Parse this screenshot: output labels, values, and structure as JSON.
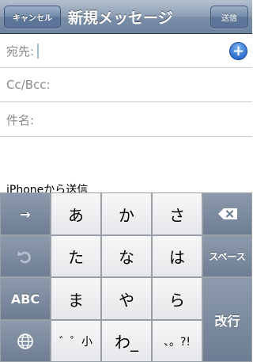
{
  "navbar": {
    "cancel_label": "キャンセル",
    "title": "新規メッセージ",
    "send_label": "送信"
  },
  "fields": {
    "to_label": "宛先:",
    "cc_label": "Cc/Bcc:",
    "subject_label": "件名:"
  },
  "body": {
    "signature": "iPhoneから送信"
  },
  "keyboard": {
    "row1": [
      "あ",
      "か",
      "さ"
    ],
    "row2": [
      "た",
      "な",
      "は"
    ],
    "row3": [
      "ま",
      "や",
      "ら"
    ],
    "row4": [
      "゛゜小",
      "わ_",
      "、。?!"
    ],
    "space_label": "スペース",
    "abc_label": "ABC",
    "return_label": "改行"
  },
  "icons": {
    "arrow": "→",
    "undo": "undo-icon",
    "globe": "globe-icon",
    "delete": "delete-icon",
    "add": "+"
  },
  "colors": {
    "navbar": "#6d83a0",
    "function_key": "#7a889d",
    "accent_blue": "#2f6fcf"
  }
}
